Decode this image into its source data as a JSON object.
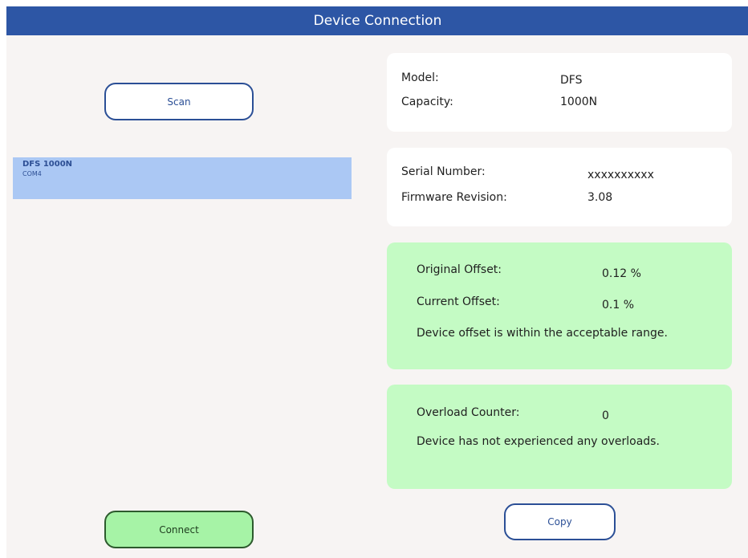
{
  "window": {
    "title": "Device Connection"
  },
  "left": {
    "scan_label": "Scan",
    "devices": [
      {
        "name": "DFS 1000N",
        "port": "COM4"
      }
    ],
    "connect_label": "Connect"
  },
  "info": {
    "model_label": "Model:",
    "model_value": "DFS",
    "capacity_label": "Capacity:",
    "capacity_value": "1000N",
    "serial_label": "Serial Number:",
    "serial_value": "xxxxxxxxxx",
    "firmware_label": "Firmware Revision:",
    "firmware_value": "3.08"
  },
  "offset": {
    "original_label": "Original Offset:",
    "original_value": "0.12 %",
    "current_label": "Current Offset:",
    "current_value": "0.1 %",
    "message": "Device offset is within the acceptable range."
  },
  "overload": {
    "counter_label": "Overload Counter:",
    "counter_value": "0",
    "message": "Device has not experienced any overloads."
  },
  "copy_label": "Copy",
  "colors": {
    "titlebar": "#2d56a5",
    "background": "#f7f4f3",
    "selected_device": "#abc8f4",
    "status_ok": "#c4fbc4",
    "connect_button": "#a6f3a6",
    "button_border": "#2b4f96"
  }
}
